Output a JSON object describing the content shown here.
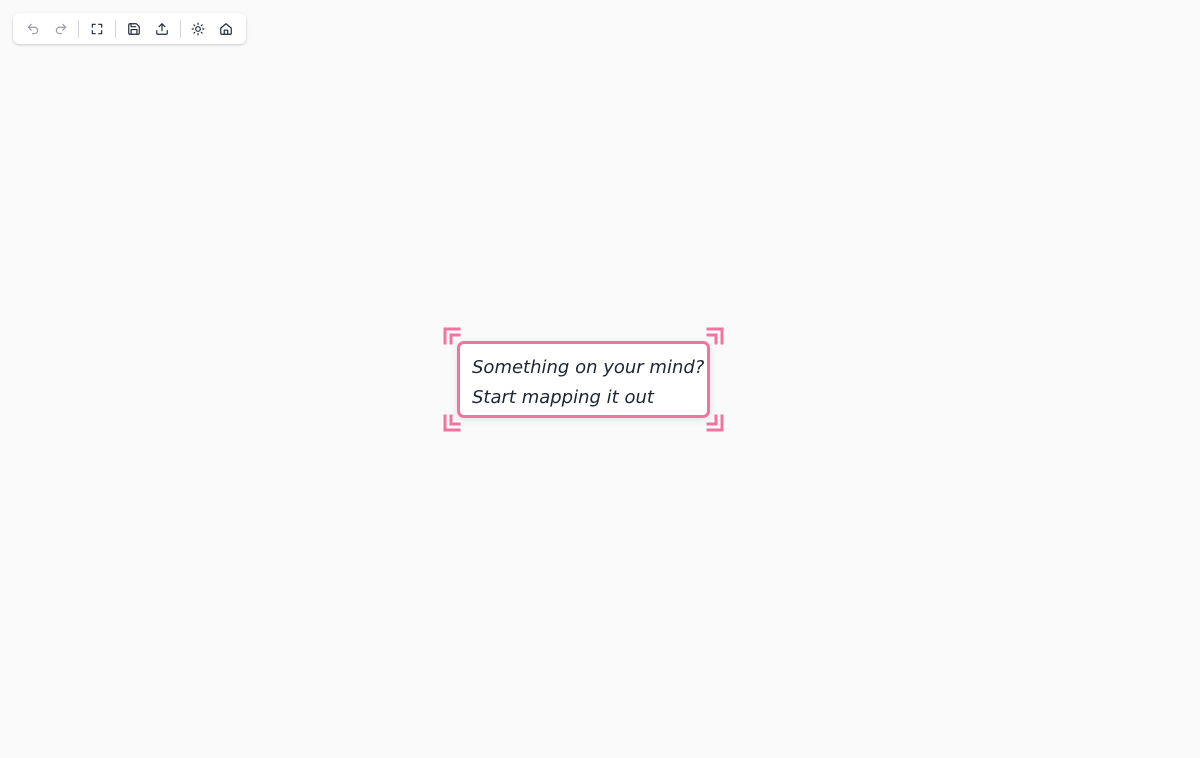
{
  "colors": {
    "canvas_background": "#fafafa",
    "accent": "#f472a0",
    "text": "#1e2433",
    "icon": "#1f2937"
  },
  "toolbar": {
    "buttons": [
      {
        "name": "undo",
        "icon": "undo-icon",
        "disabled": true
      },
      {
        "name": "redo",
        "icon": "redo-icon",
        "disabled": true
      },
      {
        "name": "fit-view",
        "icon": "fit-view-icon",
        "disabled": false
      },
      {
        "name": "save",
        "icon": "save-icon",
        "disabled": false
      },
      {
        "name": "export",
        "icon": "upload-icon",
        "disabled": false
      },
      {
        "name": "theme-toggle",
        "icon": "sun-icon",
        "disabled": false
      },
      {
        "name": "home",
        "icon": "home-icon",
        "disabled": false
      }
    ]
  },
  "root_node": {
    "line1": "Something on your mind?",
    "line2": "Start mapping it out"
  }
}
